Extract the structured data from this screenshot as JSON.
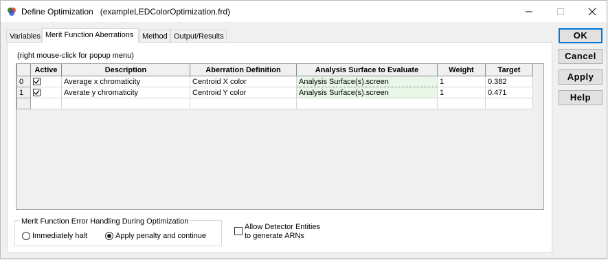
{
  "window": {
    "title": "Define Optimization",
    "filename": "(exampleLEDColorOptimization.frd)",
    "controls": {
      "minimize": "minimize-icon",
      "maximize": "maximize-icon",
      "close": "close-icon"
    }
  },
  "tabs": [
    {
      "label": "Variables",
      "active": false
    },
    {
      "label": "Merit Function Aberrations",
      "active": true
    },
    {
      "label": "Method",
      "active": false
    },
    {
      "label": "Output/Results",
      "active": false
    }
  ],
  "hint": "(right mouse-click for popup menu)",
  "table": {
    "columns": [
      "Active",
      "Description",
      "Aberration Definition",
      "Analysis Surface to Evaluate",
      "Weight",
      "Target"
    ],
    "rows": [
      {
        "index": "0",
        "active": true,
        "description": "Average x chromaticity",
        "definition": "Centroid X color",
        "surface": "Analysis Surface(s).screen",
        "weight": "1",
        "target": "0.382"
      },
      {
        "index": "1",
        "active": true,
        "description": "Averate y chromaticity",
        "definition": "Centroid Y color",
        "surface": "Analysis Surface(s).screen",
        "weight": "1",
        "target": "0.471"
      }
    ]
  },
  "error_handling": {
    "legend": "Merit Function Error Handling During Optimization",
    "options": [
      {
        "label": "Immediately halt",
        "selected": false
      },
      {
        "label": "Apply penalty and continue",
        "selected": true
      }
    ]
  },
  "detector_option": {
    "line1": "Allow Detector Entities",
    "line2": "to generate ARNs",
    "checked": false
  },
  "buttons": {
    "ok": "OK",
    "cancel": "Cancel",
    "apply": "Apply",
    "help": "Help"
  },
  "colors": {
    "accent": "#0078d7",
    "surface_cell": "#e8f7e8"
  }
}
